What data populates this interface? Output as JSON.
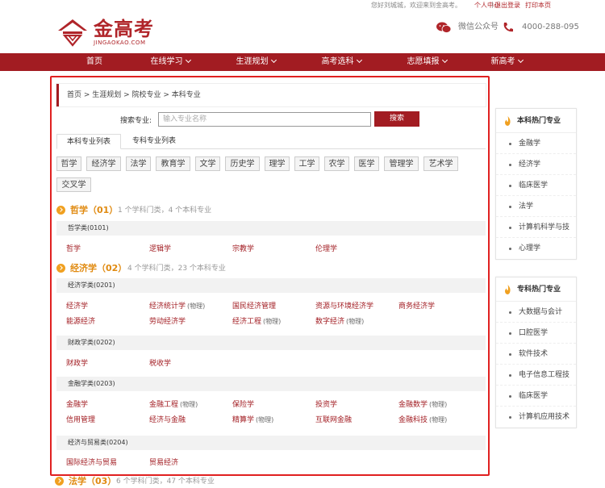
{
  "topbar": {
    "welcome": "您好刘城城，欢迎来到金高考。",
    "user_center": "个人中心",
    "logout": "退出登录",
    "print": "打印本页"
  },
  "logo": {
    "name": "金高考",
    "domain": "JINGAOKAO.COM"
  },
  "contact": {
    "wechat": "微信公众号",
    "phone": "4000-288-095"
  },
  "nav": [
    {
      "label": "首页",
      "dropdown": false
    },
    {
      "label": "在线学习",
      "dropdown": true
    },
    {
      "label": "生涯规划",
      "dropdown": true
    },
    {
      "label": "高考选科",
      "dropdown": true
    },
    {
      "label": "志愿填报",
      "dropdown": true
    },
    {
      "label": "新高考",
      "dropdown": true
    }
  ],
  "breadcrumb": "首页 > 生涯规划 > 院校专业 > 本科专业",
  "search": {
    "label": "搜索专业:",
    "placeholder": "输入专业名称",
    "button": "搜索"
  },
  "tabs": [
    "本科专业列表",
    "专科专业列表"
  ],
  "chips": [
    "哲学",
    "经济学",
    "法学",
    "教育学",
    "文学",
    "历史学",
    "理学",
    "工学",
    "农学",
    "医学",
    "管理学",
    "艺术学",
    "交叉学"
  ],
  "sections": [
    {
      "name": "哲学（01）",
      "info": "1 个学科门类，4 个本科专业",
      "categories": [
        {
          "title": "哲学类(0101)",
          "majors": [
            {
              "n": "哲学"
            },
            {
              "n": "逻辑学"
            },
            {
              "n": "宗教学"
            },
            {
              "n": "伦理学"
            }
          ]
        }
      ]
    },
    {
      "name": "经济学（02）",
      "info": "4 个学科门类，23 个本科专业",
      "categories": [
        {
          "title": "经济学类(0201)",
          "majors": [
            {
              "n": "经济学"
            },
            {
              "n": "经济统计学",
              "t": "(物理)"
            },
            {
              "n": "国民经济管理"
            },
            {
              "n": "资源与环境经济学"
            },
            {
              "n": "商务经济学"
            },
            {
              "n": "能源经济"
            },
            {
              "n": "劳动经济学"
            },
            {
              "n": "经济工程",
              "t": "(物理)"
            },
            {
              "n": "数字经济",
              "t": "(物理)"
            }
          ]
        },
        {
          "title": "财政学类(0202)",
          "majors": [
            {
              "n": "财政学"
            },
            {
              "n": "税收学"
            }
          ]
        },
        {
          "title": "金融学类(0203)",
          "majors": [
            {
              "n": "金融学"
            },
            {
              "n": "金融工程",
              "t": "(物理)"
            },
            {
              "n": "保险学"
            },
            {
              "n": "投资学"
            },
            {
              "n": "金融数学",
              "t": "(物理)"
            },
            {
              "n": "信用管理"
            },
            {
              "n": "经济与金融"
            },
            {
              "n": "精算学",
              "t": "(物理)"
            },
            {
              "n": "互联网金融"
            },
            {
              "n": "金融科技",
              "t": "(物理)"
            }
          ]
        },
        {
          "title": "经济与贸易类(0204)",
          "majors": [
            {
              "n": "国际经济与贸易"
            },
            {
              "n": "贸易经济"
            }
          ]
        }
      ]
    },
    {
      "name": "法学（03）",
      "info": "6 个学科门类，47 个本科专业",
      "categories": []
    }
  ],
  "hot_bachelor": {
    "title": "本科热门专业",
    "items": [
      "金融学",
      "经济学",
      "临床医学",
      "法学",
      "计算机科学与技",
      "心理学"
    ]
  },
  "hot_college": {
    "title": "专科热门专业",
    "items": [
      "大数据与会计",
      "口腔医学",
      "软件技术",
      "电子信息工程技",
      "临床医学",
      "计算机应用技术"
    ]
  },
  "colors": {
    "brand": "#a21c22",
    "accent": "#e08a10",
    "highlight_border": "#e02020"
  }
}
